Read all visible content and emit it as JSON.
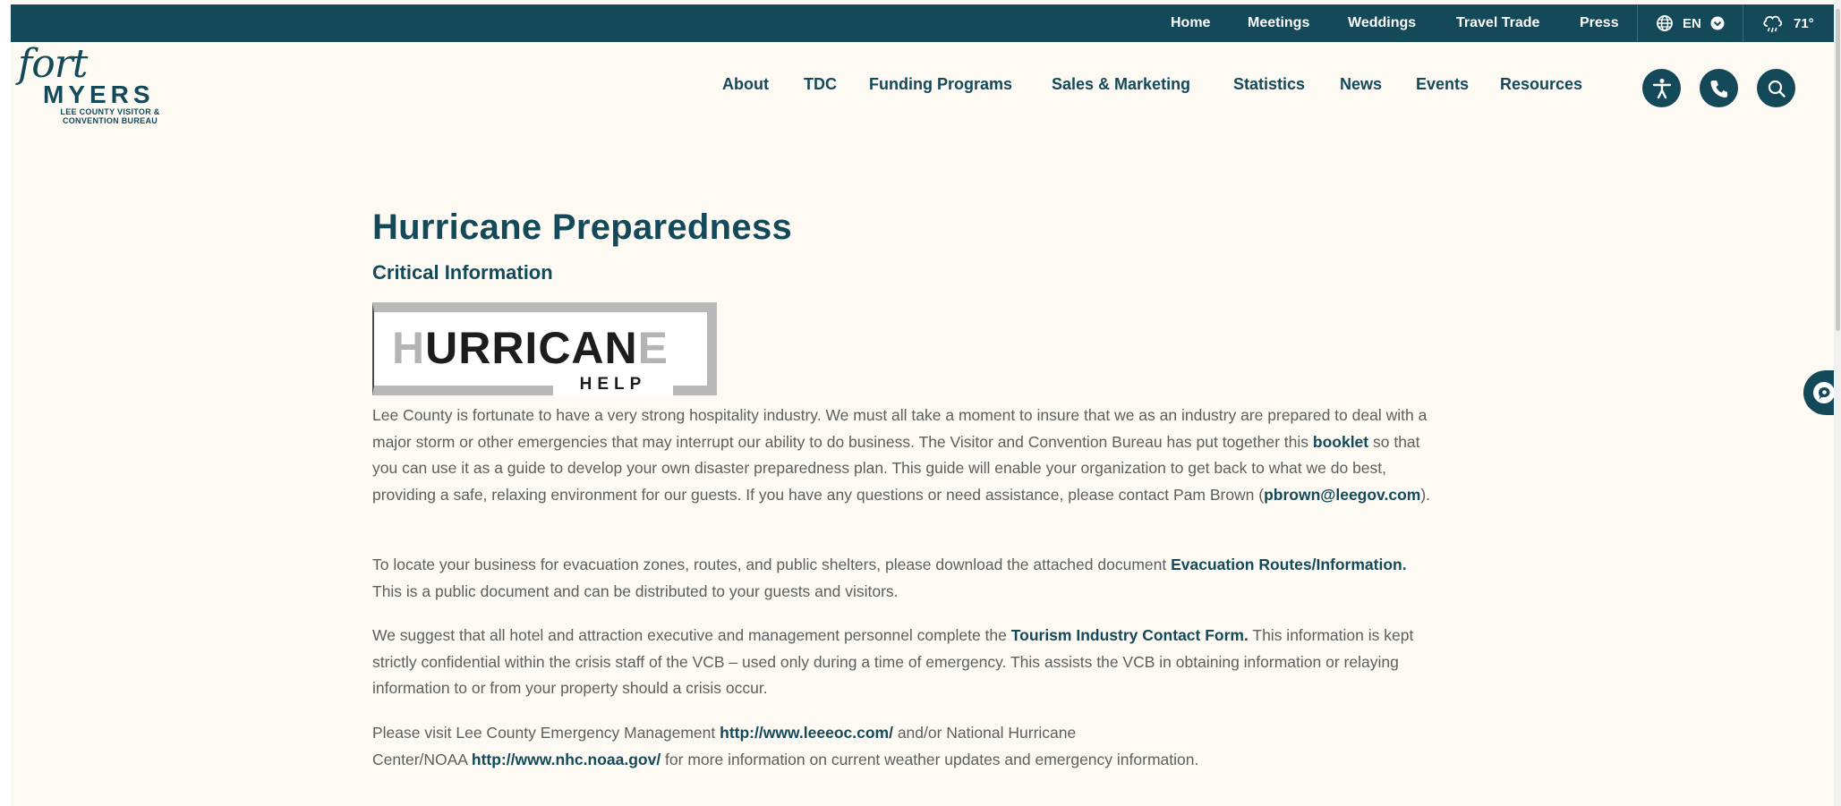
{
  "topbar": {
    "links": [
      "Home",
      "Meetings",
      "Weddings",
      "Travel Trade",
      "Press"
    ],
    "language": "EN",
    "temperature": "71°"
  },
  "logo": {
    "script": "fort",
    "name": "MYERS",
    "tagline": "LEE COUNTY VISITOR & CONVENTION BUREAU"
  },
  "nav": {
    "items": [
      "About",
      "TDC",
      "Funding Programs",
      "Sales & Marketing",
      "Statistics",
      "News",
      "Events",
      "Resources"
    ]
  },
  "header_icons": [
    "accessibility-icon",
    "phone-icon",
    "search-icon"
  ],
  "main": {
    "title": "Hurricane Preparedness",
    "subtitle": "Critical Information",
    "banner": {
      "word_gray_1": "H",
      "word_dark_1": "URRI",
      "word_dark_2": "CAN",
      "word_gray_2": "E",
      "help": "HELP"
    },
    "p1": {
      "t1": "Lee County is fortunate to have a very strong hospitality industry. We must all take a moment to insure that we as an industry are prepared to deal with a major storm or other emergencies that may interrupt our ability to do business. The Visitor and Convention Bureau has put together this ",
      "link1": "booklet",
      "t2": " so that you can use it as a guide to develop your own disaster preparedness plan. This guide will enable your organization to get back to what we do best, providing a safe, relaxing environment for our guests. If you have any questions or need assistance, please contact Pam Brown (",
      "link2": "pbrown@leegov.com",
      "t3": ")."
    },
    "p2": {
      "t1": "To locate your business for evacuation zones, routes, and public shelters, please download the attached document ",
      "link1": "Evacuation Routes/Information.",
      "t2": " This is a public document and can be distributed to your guests and visitors."
    },
    "p3": {
      "t1": "We suggest that all hotel and attraction executive and management personnel complete the ",
      "link1": "Tourism Industry Contact Form.",
      "t2": " This information is kept strictly confidential within the crisis staff of the VCB – used only during a time of emergency. This assists the VCB in obtaining information or relaying information to or from your property should a crisis occur."
    },
    "p4": {
      "t1": "Please visit Lee County Emergency Management ",
      "link1": "http://www.leeeoc.com/",
      "t2": " and/or National Hurricane",
      "t3": "Center/NOAA ",
      "link2": "http://www.nhc.noaa.gov/",
      "t4": " for more information on current weather updates and emergency information."
    }
  },
  "colors": {
    "brand": "#14495a",
    "background": "#fdfaf3",
    "text": "#5e5e5e"
  }
}
